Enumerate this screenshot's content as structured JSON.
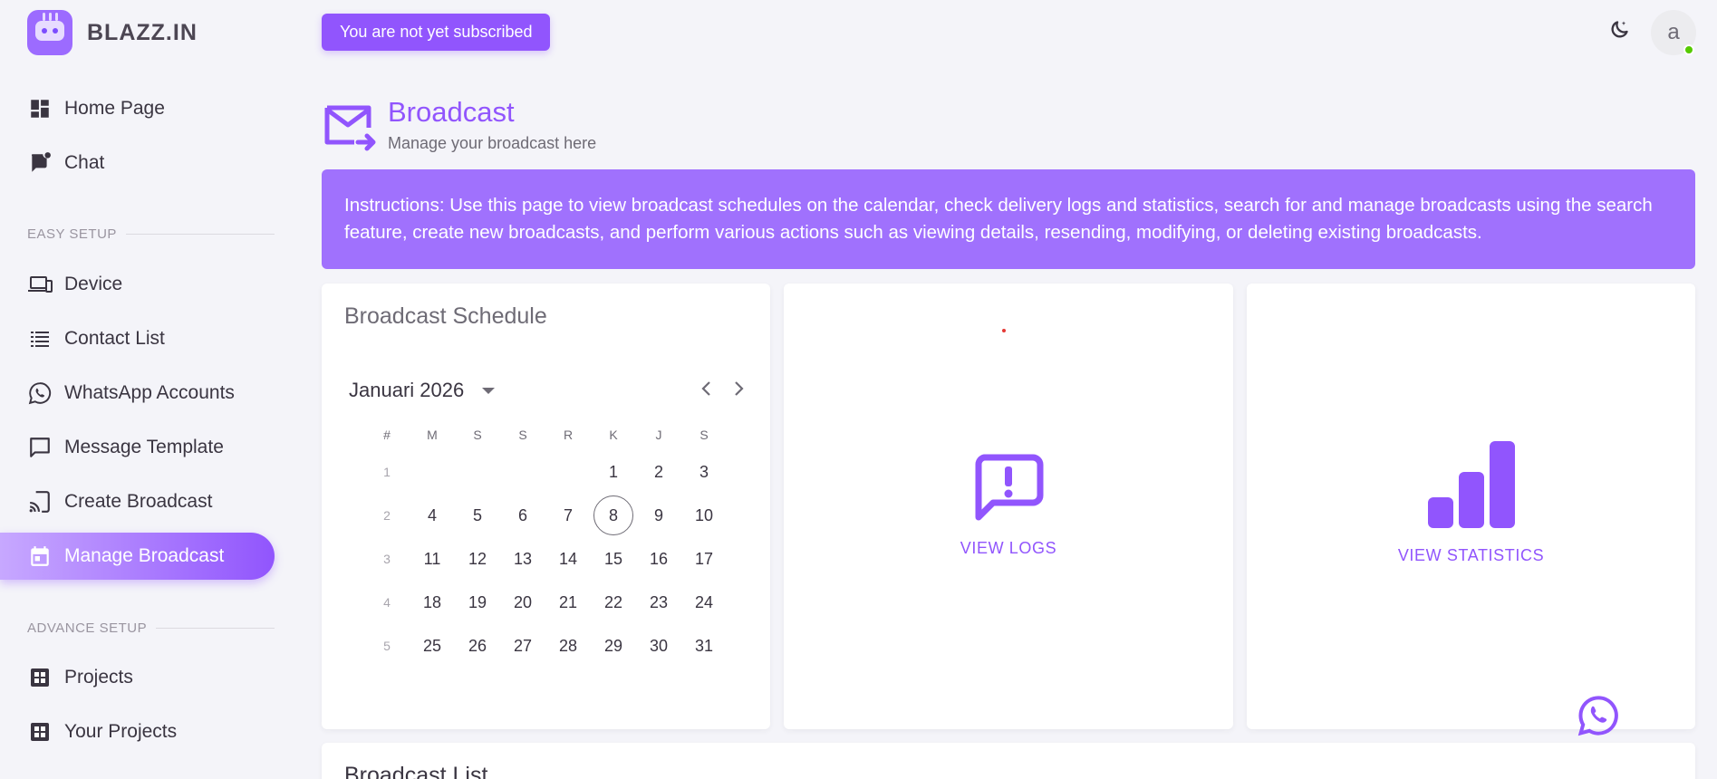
{
  "app": {
    "name": "BLAZZ.IN"
  },
  "sidebar": {
    "items": [
      {
        "label": "Home Page"
      },
      {
        "label": "Chat"
      },
      {
        "label": "Device"
      },
      {
        "label": "Contact List"
      },
      {
        "label": "WhatsApp Accounts"
      },
      {
        "label": "Message Template"
      },
      {
        "label": "Create Broadcast"
      },
      {
        "label": "Manage Broadcast"
      },
      {
        "label": "Projects"
      },
      {
        "label": "Your Projects"
      }
    ],
    "sections": {
      "easy_setup": "EASY SETUP",
      "advance_setup": "ADVANCE SETUP"
    },
    "active": "Manage Broadcast"
  },
  "topbar": {
    "subscription_notice": "You are not yet subscribed",
    "avatar_initial": "a"
  },
  "page": {
    "title": "Broadcast",
    "subtitle": "Manage your broadcast here",
    "instructions": "Instructions: Use this page to view broadcast schedules on the calendar, check delivery logs and statistics, search for and manage broadcasts using the search feature, create new broadcasts, and perform various actions such as viewing details, resending, modifying, or deleting existing broadcasts."
  },
  "schedule": {
    "title": "Broadcast Schedule",
    "month_label": "Januari 2026",
    "weekday_headers": [
      "#",
      "M",
      "S",
      "S",
      "R",
      "K",
      "J",
      "S"
    ],
    "weeks": [
      {
        "num": "1",
        "days": [
          "",
          "",
          "",
          "",
          "1",
          "2",
          "3"
        ]
      },
      {
        "num": "2",
        "days": [
          "4",
          "5",
          "6",
          "7",
          "8",
          "9",
          "10"
        ]
      },
      {
        "num": "3",
        "days": [
          "11",
          "12",
          "13",
          "14",
          "15",
          "16",
          "17"
        ]
      },
      {
        "num": "4",
        "days": [
          "18",
          "19",
          "20",
          "21",
          "22",
          "23",
          "24"
        ]
      },
      {
        "num": "5",
        "days": [
          "25",
          "26",
          "27",
          "28",
          "29",
          "30",
          "31"
        ]
      }
    ],
    "today": "8"
  },
  "logs": {
    "label": "VIEW LOGS"
  },
  "stats": {
    "label": "VIEW STATISTICS"
  },
  "list": {
    "title": "Broadcast List"
  },
  "colors": {
    "accent": "#9155fd",
    "banner": "#a071fd",
    "background": "#f4f4f9"
  }
}
